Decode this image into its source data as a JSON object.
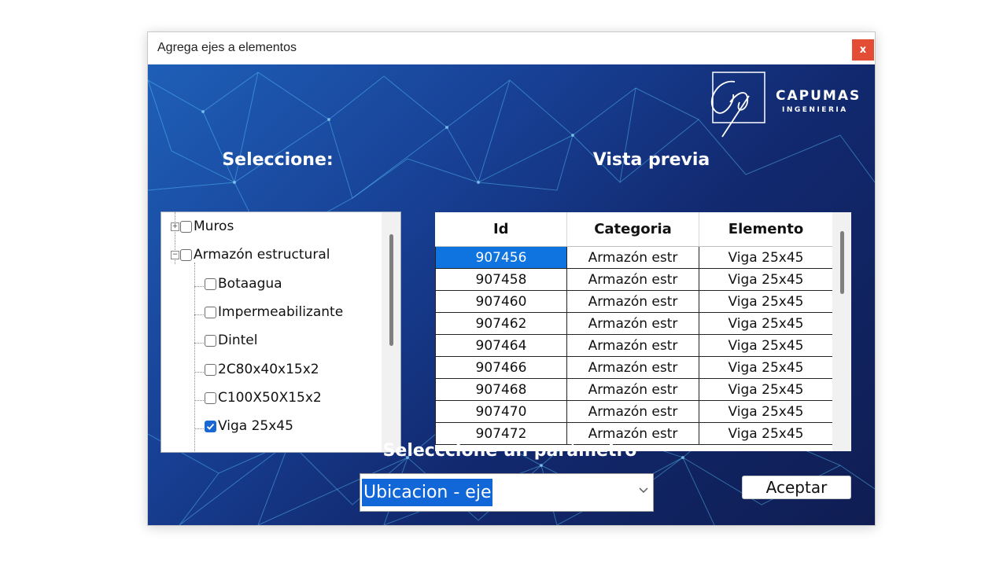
{
  "window": {
    "title": "Agrega ejes a elementos",
    "close_label": "x"
  },
  "logo": {
    "name": "CAPUMAS",
    "subtitle": "INGENIERIA"
  },
  "left_panel": {
    "heading": "Seleccione:",
    "tree": [
      {
        "label": "Muros",
        "expander": "+",
        "checked": false
      },
      {
        "label": "Armazón estructural",
        "expander": "−",
        "checked": false
      },
      {
        "label": "Botaagua",
        "checked": false
      },
      {
        "label": "Impermeabilizante",
        "checked": false
      },
      {
        "label": "Dintel",
        "checked": false
      },
      {
        "label": "2C80x40x15x2",
        "checked": false
      },
      {
        "label": "C100X50X15x2",
        "checked": false
      },
      {
        "label": "Viga 25x45",
        "checked": true
      }
    ]
  },
  "preview": {
    "heading": "Vista previa",
    "columns": [
      "Id",
      "Categoria",
      "Elemento"
    ],
    "rows": [
      [
        "907456",
        "Armazón estr",
        "Viga 25x45"
      ],
      [
        "907458",
        "Armazón estr",
        "Viga 25x45"
      ],
      [
        "907460",
        "Armazón estr",
        "Viga 25x45"
      ],
      [
        "907462",
        "Armazón estr",
        "Viga 25x45"
      ],
      [
        "907464",
        "Armazón estr",
        "Viga 25x45"
      ],
      [
        "907466",
        "Armazón estr",
        "Viga 25x45"
      ],
      [
        "907468",
        "Armazón estr",
        "Viga 25x45"
      ],
      [
        "907470",
        "Armazón estr",
        "Viga 25x45"
      ],
      [
        "907472",
        "Armazón estr",
        "Viga 25x45"
      ]
    ]
  },
  "parameter": {
    "heading": "Selecccione un parámetro",
    "selected": "Ubicacion - eje"
  },
  "accept_label": "Aceptar",
  "colors": {
    "accent": "#1167d8",
    "close": "#e34c35",
    "background_dark": "#0f1d52"
  }
}
